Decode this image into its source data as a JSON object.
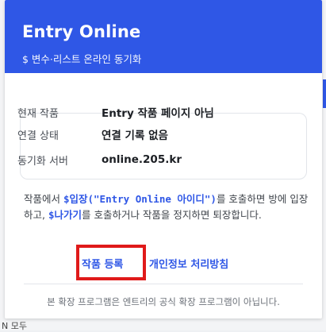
{
  "header": {
    "title": "Entry Online",
    "subtitle": "$ 변수·리스트 온라인 동기화"
  },
  "status": {
    "rows": [
      {
        "label": "현재 작품",
        "value": "Entry 작품 페이지 아님"
      },
      {
        "label": "연결 상태",
        "value": "연결 기록 없음"
      },
      {
        "label": "동기화 서버",
        "value": "online.205.kr"
      }
    ]
  },
  "description": {
    "part1": "작품에서 ",
    "code1": "$입장(\"Entry Online 아이디\")",
    "part2": "를 호출하면 방에 입장하고, ",
    "code2": "$나가기",
    "part3": "를 호출하거나 작품을 정지하면 퇴장합니다."
  },
  "links": {
    "register": "작품 등록",
    "privacy": "개인정보 처리방침"
  },
  "footer": {
    "notice": "본 확장 프로그램은 엔트리의 공식 확장 프로그램이 아닙니다."
  },
  "backdrop": {
    "bottom_text": "N   모두"
  },
  "colors": {
    "accent": "#2f57e6",
    "highlight": "#e01a1a"
  }
}
